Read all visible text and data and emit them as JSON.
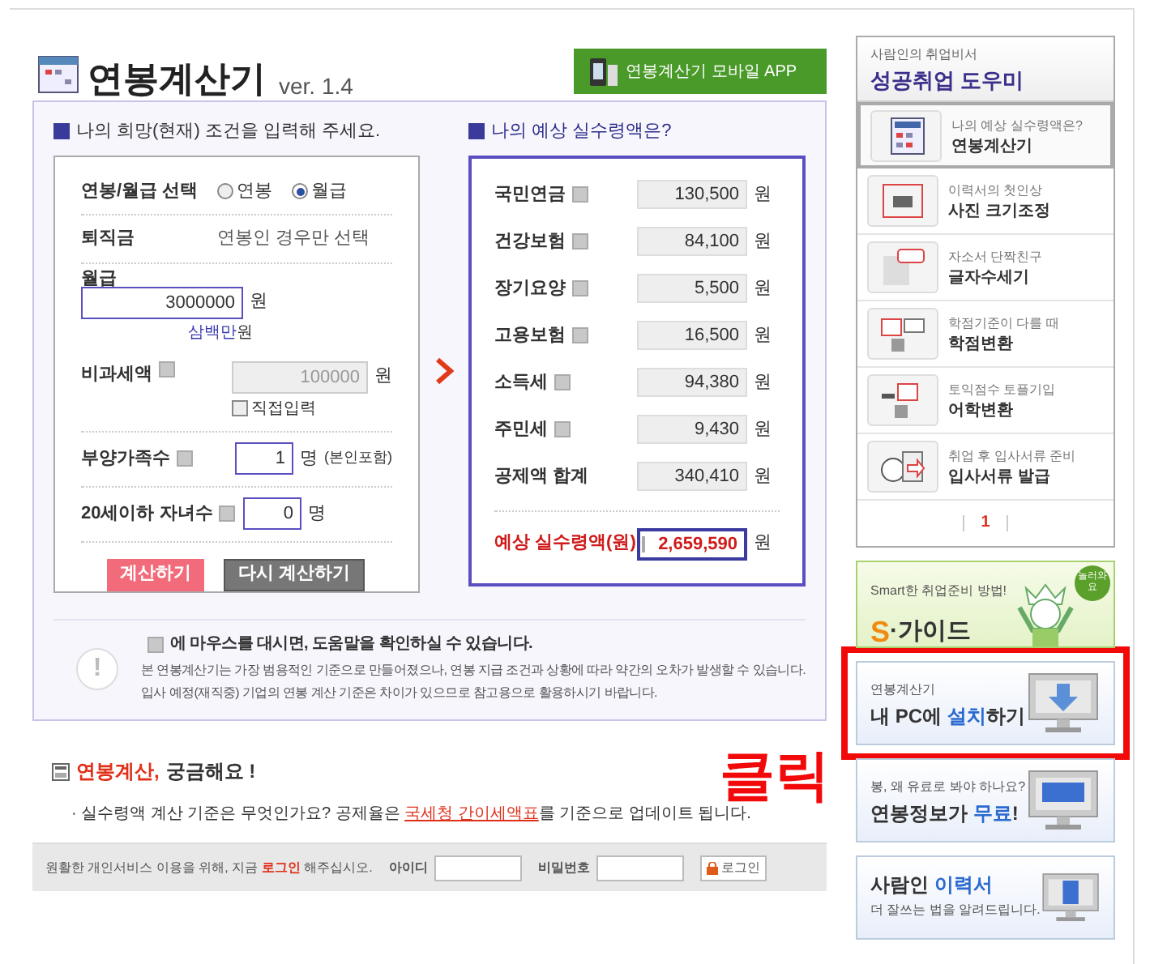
{
  "header": {
    "title": "연봉계산기",
    "version": "ver. 1.4",
    "mobile_button": "연봉계산기 모바일 APP"
  },
  "input_section": {
    "title": "나의 희망(현재) 조건을 입력해 주세요.",
    "pay_type": {
      "label": "연봉/월급 선택",
      "options": [
        {
          "label": "연봉",
          "selected": false
        },
        {
          "label": "월급",
          "selected": true
        }
      ]
    },
    "severance": {
      "label": "퇴직금",
      "note": "연봉인 경우만 선택"
    },
    "salary": {
      "label": "월급",
      "value": "3000000",
      "unit": "원",
      "reading_amount": "삼백만",
      "reading_unit": "원"
    },
    "nontax": {
      "label": "비과세액",
      "value": "100000",
      "unit": "원",
      "disabled": true,
      "direct_input": {
        "label": "직접입력",
        "checked": false
      }
    },
    "dependents": {
      "label": "부양가족수",
      "value": "1",
      "unit": "명",
      "note": "(본인포함)"
    },
    "children": {
      "label": "20세이하 자녀수",
      "value": "0",
      "unit": "명"
    },
    "buttons": [
      {
        "label": "계산하기",
        "kind": "primary"
      },
      {
        "label": "다시 계산하기",
        "kind": "secondary"
      }
    ]
  },
  "result_section": {
    "title": "나의 예상 실수령액은?",
    "rows": [
      {
        "label": "국민연금",
        "help": true,
        "value": "130,500",
        "unit": "원"
      },
      {
        "label": "건강보험",
        "help": true,
        "value": "84,100",
        "unit": "원"
      },
      {
        "label": "장기요양",
        "help": true,
        "value": "5,500",
        "unit": "원"
      },
      {
        "label": "고용보험",
        "help": true,
        "value": "16,500",
        "unit": "원"
      },
      {
        "label": "소득세",
        "help": true,
        "value": "94,380",
        "unit": "원"
      },
      {
        "label": "주민세",
        "help": true,
        "value": "9,430",
        "unit": "원"
      },
      {
        "label": "공제액 합계",
        "help": false,
        "value": "340,410",
        "unit": "원"
      }
    ],
    "total": {
      "label": "예상 실수령액(원)",
      "value": "2,659,590",
      "unit": "원"
    }
  },
  "notice": {
    "icon": "!",
    "heading": "에 마우스를 대시면, 도움말을 확인하실 수 있습니다.",
    "lines": [
      "본 연봉계산기는 가장 범용적인 기준으로 만들어졌으나, 연봉 지급 조건과 상황에 따라 약간의 오차가 발생할 수 있습니다.",
      "입사 예정(재직중) 기업의 연봉 계산 기준은 차이가 있으므로 참고용으로 활용하시기 바랍니다."
    ]
  },
  "faq": {
    "title_highlight": "연봉계산,",
    "title_rest": "궁금해요 !",
    "items": [
      {
        "before": "· 실수령액 계산 기준은 무엇인가요? 공제율은 ",
        "link": "국세청 간이세액표",
        "after": "를 기준으로 업데이트 됩니다."
      }
    ]
  },
  "login_bar": {
    "before": "원활한 개인서비스 이용을 위해, 지금 ",
    "link": "로그인",
    "after": " 해주십시오.",
    "id_label": "아이디",
    "password_label": "비밀번호",
    "button": "로그인"
  },
  "annotation": "클릭",
  "sidebar": {
    "subtitle": "사람인의 취업비서",
    "title": "성공취업 도우미",
    "items": [
      {
        "caption": "나의 예상 실수령액은?",
        "label": "연봉계산기",
        "selected": true
      },
      {
        "caption": "이력서의 첫인상",
        "label": "사진 크기조정",
        "selected": false
      },
      {
        "caption": "자소서 단짝친구",
        "label": "글자수세기",
        "selected": false
      },
      {
        "caption": "학점기준이 다를 때",
        "label": "학점변환",
        "selected": false
      },
      {
        "caption": "토익점수 토플기입",
        "label": "어학변환",
        "selected": false
      },
      {
        "caption": "취업 후 입사서류 준비",
        "label": "입사서류 발급",
        "selected": false
      }
    ],
    "pages": [
      {
        "label": "1",
        "selected": true
      }
    ]
  },
  "banners": [
    {
      "kind": "guide",
      "caption": "Smart한 취업준비 방법!",
      "title": "S",
      "title_rest": "·가이드",
      "badge": "놀러와요",
      "highlighted": false
    },
    {
      "kind": "install",
      "caption": "연봉계산기",
      "before": "내 PC에 ",
      "highlight": "설치",
      "after": "하기",
      "highlighted": true
    },
    {
      "kind": "free",
      "caption": "봉, 왜 유료로 봐야 하나요?",
      "before": "연봉정보가 ",
      "highlight": "무료",
      "after": "!",
      "highlighted": false
    },
    {
      "kind": "resume",
      "before": "사람인 ",
      "highlight": "이력서",
      "caption": "더 잘쓰는 법을 알려드립니다.",
      "highlighted": false
    }
  ]
}
